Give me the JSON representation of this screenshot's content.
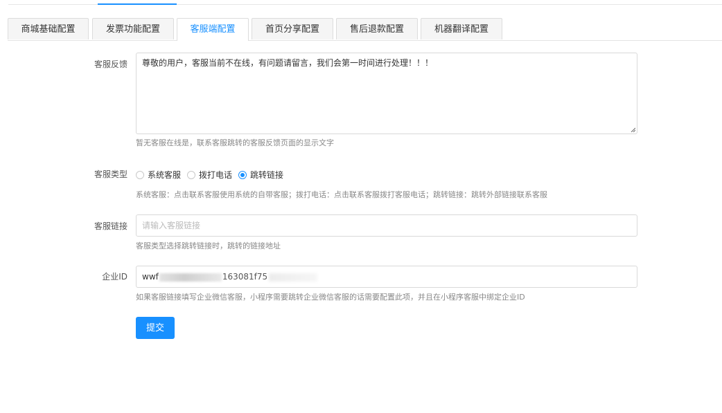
{
  "tabs": [
    {
      "label": "商城基础配置",
      "active": false
    },
    {
      "label": "发票功能配置",
      "active": false
    },
    {
      "label": "客服端配置",
      "active": true
    },
    {
      "label": "首页分享配置",
      "active": false
    },
    {
      "label": "售后退款配置",
      "active": false
    },
    {
      "label": "机器翻译配置",
      "active": false
    }
  ],
  "form": {
    "feedback": {
      "label": "客服反馈",
      "value": "尊敬的用户，客服当前不在线，有问题请留言，我们会第一时间进行处理！！！",
      "hint": "暂无客服在线是，联系客服跳转的客服反馈页面的显示文字"
    },
    "type": {
      "label": "客服类型",
      "options": [
        "系统客服",
        "拨打电话",
        "跳转链接"
      ],
      "selected": "跳转链接",
      "hint": "系统客服：点击联系客服使用系统的自带客服；拨打电话：点击联系客服拨打客服电话；跳转链接：跳转外部链接联系客服"
    },
    "link": {
      "label": "客服链接",
      "placeholder": "请输入客服链接",
      "value": "",
      "hint": "客服类型选择跳转链接时，跳转的链接地址"
    },
    "corp_id": {
      "label": "企业ID",
      "value_prefix": "wwf",
      "value_suffix": "163081f75",
      "hint": "如果客服链接填写企业微信客服，小程序需要跳转企业微信客服的话需要配置此项，并且在小程序客服中绑定企业ID"
    },
    "submit_label": "提交"
  },
  "colors": {
    "accent": "#1890ff",
    "hint": "#888888",
    "border": "#d9d9d9"
  },
  "icons": {
    "radio_unchecked": "radio-unchecked-icon",
    "radio_checked": "radio-checked-icon",
    "resize_grip": "resize-grip-icon"
  }
}
